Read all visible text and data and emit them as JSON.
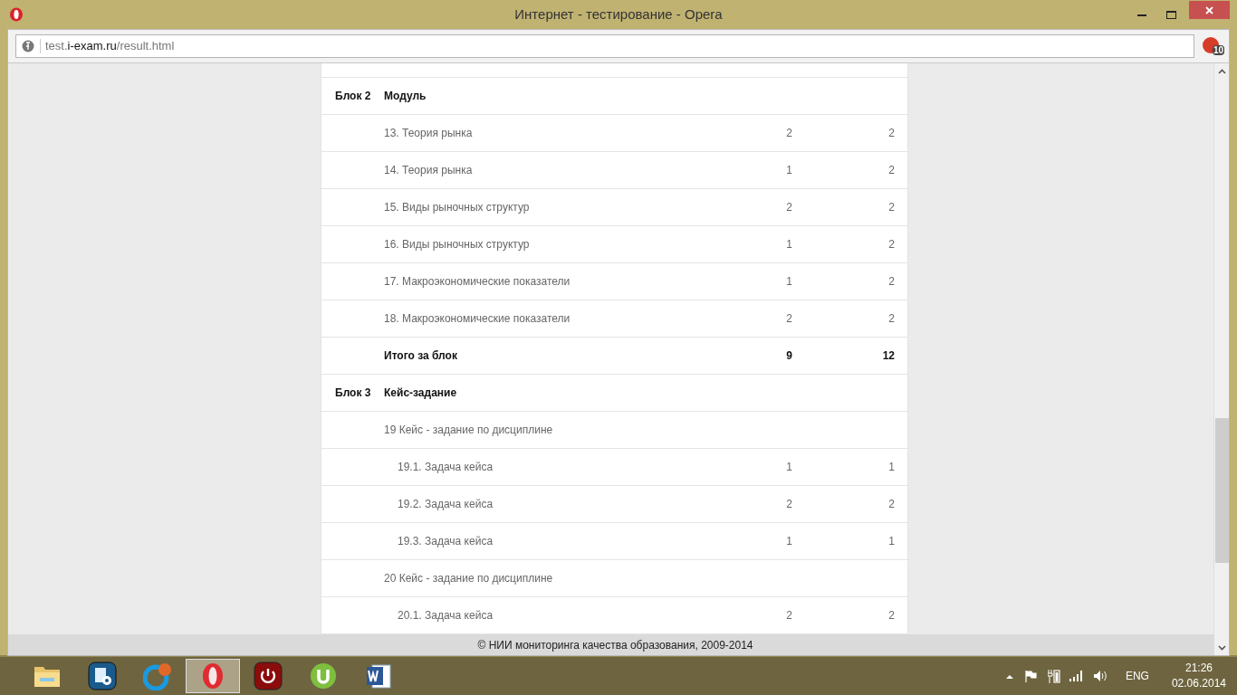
{
  "window": {
    "title": "Интернет - тестирование - Opera"
  },
  "address_bar": {
    "url_prefix": "test.",
    "url_domain": "i-exam.ru",
    "url_path": "/result.html"
  },
  "extension_badge": {
    "count": "10"
  },
  "rows": [
    {
      "kind": "block",
      "block": "Блок 2",
      "label": "Модуль"
    },
    {
      "kind": "item",
      "label": "13. Теория рынка",
      "score": "2",
      "max": "2"
    },
    {
      "kind": "item",
      "label": "14. Теория рынка",
      "score": "1",
      "max": "2"
    },
    {
      "kind": "item",
      "label": "15. Виды рыночных структур",
      "score": "2",
      "max": "2"
    },
    {
      "kind": "item",
      "label": "16. Виды рыночных структур",
      "score": "1",
      "max": "2"
    },
    {
      "kind": "item",
      "label": "17. Макроэкономические показатели",
      "score": "1",
      "max": "2"
    },
    {
      "kind": "item",
      "label": "18. Макроэкономические показатели",
      "score": "2",
      "max": "2"
    },
    {
      "kind": "total",
      "label": "Итого за блок",
      "score": "9",
      "max": "12"
    },
    {
      "kind": "block",
      "block": "Блок 3",
      "label": "Кейс-задание"
    },
    {
      "kind": "item",
      "label": "19 Кейс - задание по дисциплине"
    },
    {
      "kind": "subitem",
      "label": "19.1. Задача кейса",
      "score": "1",
      "max": "1"
    },
    {
      "kind": "subitem",
      "label": "19.2. Задача кейса",
      "score": "2",
      "max": "2"
    },
    {
      "kind": "subitem",
      "label": "19.3. Задача кейса",
      "score": "1",
      "max": "1"
    },
    {
      "kind": "item",
      "label": "20 Кейс - задание по дисциплине"
    },
    {
      "kind": "subitem",
      "label": "20.1. Задача кейса",
      "score": "2",
      "max": "2"
    }
  ],
  "footer": "© НИИ мониторинга качества образования, 2009-2014",
  "taskbar": {
    "apps": [
      {
        "kind": "explorer",
        "selected": false
      },
      {
        "kind": "settings",
        "selected": false
      },
      {
        "kind": "chat",
        "selected": false
      },
      {
        "kind": "opera",
        "selected": true
      },
      {
        "kind": "power",
        "selected": false
      },
      {
        "kind": "torrent",
        "selected": false
      },
      {
        "kind": "word",
        "selected": false
      }
    ],
    "language": "ENG",
    "time": "21:26",
    "date": "02.06.2014"
  }
}
